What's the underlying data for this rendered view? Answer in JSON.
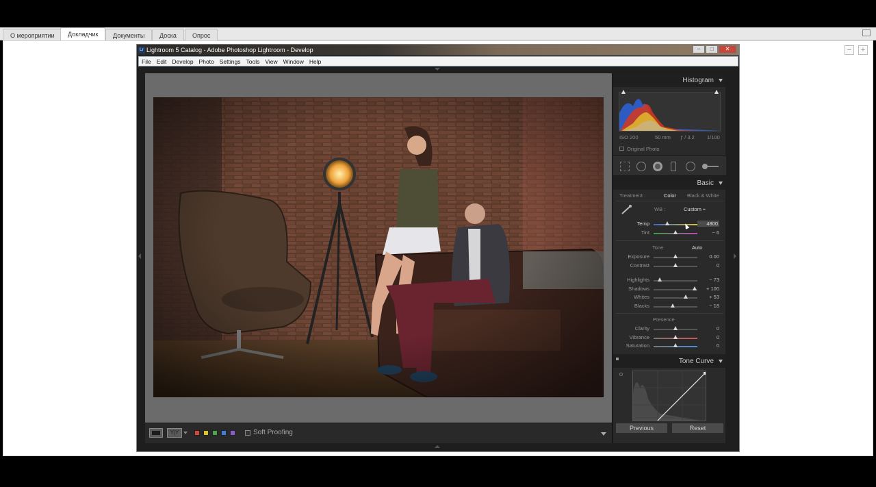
{
  "browser_tabs": [
    {
      "label": "О мероприятии",
      "active": false
    },
    {
      "label": "Докладчик",
      "active": true
    },
    {
      "label": "Документы",
      "active": false
    },
    {
      "label": "Доска",
      "active": false
    },
    {
      "label": "Опрос",
      "active": false
    }
  ],
  "zoom_controls": {
    "minus": "−",
    "plus": "+"
  },
  "lightroom": {
    "title": "Lightroom 5 Catalog - Adobe Photoshop Lightroom - Develop",
    "logo": "Lr",
    "menu": [
      "File",
      "Edit",
      "Develop",
      "Photo",
      "Settings",
      "Tools",
      "View",
      "Window",
      "Help"
    ],
    "histogram": {
      "title": "Histogram",
      "iso": "ISO 200",
      "focal": "50 mm",
      "aperture": "ƒ / 3.2",
      "shutter": "1/100",
      "original_photo": "Original Photo"
    },
    "basic": {
      "title": "Basic",
      "treatment_label": "Treatment :",
      "color": "Color",
      "bw": "Black & White",
      "wb_label": "WB :",
      "wb_value": "Custom ÷",
      "temp_label": "Temp",
      "temp_value": "4800",
      "tint_label": "Tint",
      "tint_value": "− 6",
      "tone_label": "Tone",
      "auto": "Auto",
      "exposure_label": "Exposure",
      "exposure_value": "0.00",
      "contrast_label": "Contrast",
      "contrast_value": "0",
      "highlights_label": "Highlights",
      "highlights_value": "− 73",
      "shadows_label": "Shadows",
      "shadows_value": "+ 100",
      "whites_label": "Whites",
      "whites_value": "+ 53",
      "blacks_label": "Blacks",
      "blacks_value": "− 18",
      "presence_label": "Presence",
      "clarity_label": "Clarity",
      "clarity_value": "0",
      "vibrance_label": "Vibrance",
      "vibrance_value": "0",
      "saturation_label": "Saturation",
      "saturation_value": "0"
    },
    "tone_curve": {
      "title": "Tone Curve"
    },
    "buttons": {
      "previous": "Previous",
      "reset": "Reset"
    },
    "toolbar": {
      "soft_proofing": "Soft Proofing",
      "compare": "Y|Y"
    },
    "swatch_colors": [
      "#d0453b",
      "#d9c22e",
      "#4ba64a",
      "#3d7fd1",
      "#8a5bd1"
    ],
    "slider_levels": {
      "temp": 0.3,
      "tint": 0.49,
      "exposure": 0.5,
      "contrast": 0.5,
      "highlights": 0.14,
      "shadows": 0.94,
      "whites": 0.73,
      "blacks": 0.43,
      "clarity": 0.5,
      "vibrance": 0.5,
      "saturation": 0.5
    }
  }
}
